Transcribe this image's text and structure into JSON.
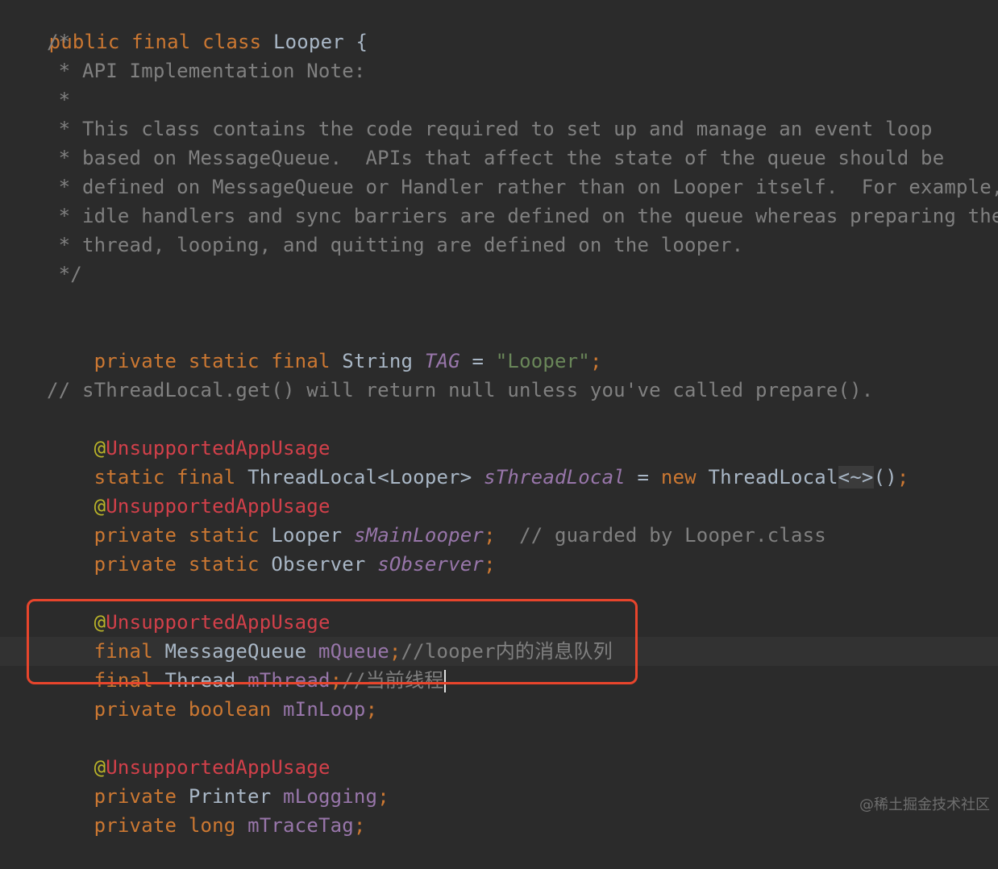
{
  "editor": {
    "lines": {
      "l1": {
        "kw1": "public",
        "kw2": "final",
        "kw3": "class",
        "name": "Looper",
        "brace": "{"
      },
      "l2": {
        "text": "/*"
      },
      "l3": {
        "text": " * API Implementation Note:"
      },
      "l4": {
        "text": " *"
      },
      "l5": {
        "text": " * This class contains the code required to set up and manage an event loop"
      },
      "l6": {
        "text": " * based on MessageQueue.  APIs that affect the state of the queue should be"
      },
      "l7": {
        "text": " * defined on MessageQueue or Handler rather than on Looper itself.  For example,"
      },
      "l8": {
        "text": " * idle handlers and sync barriers are defined on the queue whereas preparing the"
      },
      "l9": {
        "text": " * thread, looping, and quitting are defined on the looper."
      },
      "l10": {
        "text": " */"
      },
      "l11": {
        "kw1": "private",
        "kw2": "static",
        "kw3": "final",
        "type": "String",
        "field": "TAG",
        "eq": "=",
        "value": "\"Looper\"",
        "semi": ";"
      },
      "l12": {
        "text": "// sThreadLocal.get() will return null unless you've called prepare()."
      },
      "l13": {
        "at": "@",
        "name": "UnsupportedAppUsage"
      },
      "l14": {
        "kw1": "static",
        "kw2": "final",
        "type": "ThreadLocal<Looper>",
        "field": "sThreadLocal",
        "eq": "=",
        "kw3": "new",
        "type2": "ThreadLocal",
        "diamond": "<~>",
        "call": "()",
        "semi": ";"
      },
      "l15": {
        "at": "@",
        "name": "UnsupportedAppUsage"
      },
      "l16": {
        "kw1": "private",
        "kw2": "static",
        "type": "Looper",
        "field": "sMainLooper",
        "semi": ";",
        "comment": "// guarded by Looper.class"
      },
      "l17": {
        "kw1": "private",
        "kw2": "static",
        "type": "Observer",
        "field": "sObserver",
        "semi": ";"
      },
      "l18": {
        "at": "@",
        "name": "UnsupportedAppUsage"
      },
      "l19": {
        "kw1": "final",
        "type": "MessageQueue",
        "field": "mQueue",
        "semi": ";",
        "comment": "//looper内的消息队列"
      },
      "l20": {
        "kw1": "final",
        "type": "Thread",
        "field": "mThread",
        "semi": ";",
        "comment": "//当前线程"
      },
      "l21": {
        "kw1": "private",
        "kw2": "boolean",
        "field": "mInLoop",
        "semi": ";"
      },
      "l22": {
        "at": "@",
        "name": "UnsupportedAppUsage"
      },
      "l23": {
        "kw1": "private",
        "type": "Printer",
        "field": "mLogging",
        "semi": ";"
      },
      "l24": {
        "kw1": "private",
        "kw2": "long",
        "field": "mTraceTag",
        "semi": ";"
      }
    }
  },
  "watermark": "@稀土掘金技术社区",
  "colors": {
    "background": "#2b2b2b",
    "keyword": "#cc7832",
    "comment": "#808080",
    "annotation": "#bbb529",
    "annotation_name": "#d2404a",
    "field": "#9876aa",
    "string": "#6a8759",
    "plain": "#a9b7c6",
    "highlight_box": "#e8452c"
  }
}
